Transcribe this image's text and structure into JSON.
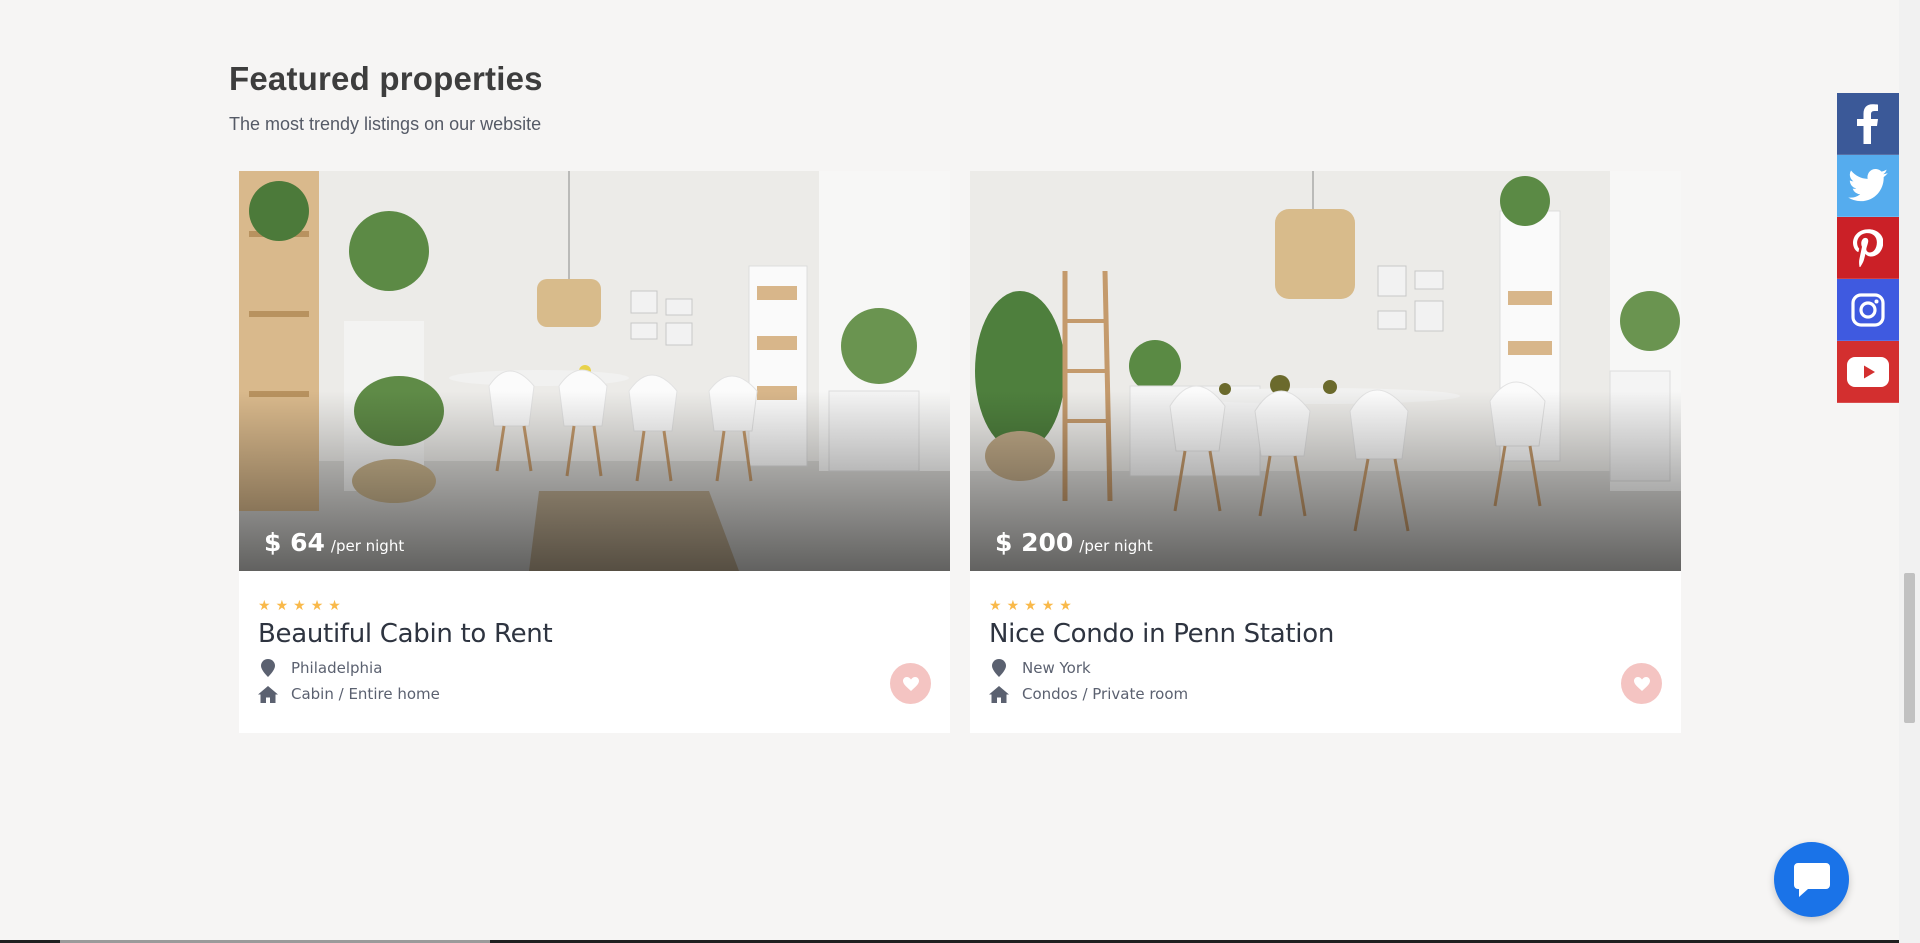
{
  "section": {
    "title": "Featured properties",
    "subtitle": "The most trendy listings on our website"
  },
  "listings": [
    {
      "price": "$ 64",
      "price_unit": "/per night",
      "rating": 5,
      "title": "Beautiful Cabin to Rent",
      "location": "Philadelphia",
      "type": "Cabin / Entire home"
    },
    {
      "price": "$ 200",
      "price_unit": "/per night",
      "rating": 5,
      "title": "Nice Condo in Penn Station",
      "location": "New York",
      "type": "Condos / Private room"
    }
  ],
  "social": [
    {
      "name": "facebook",
      "icon": "facebook-icon",
      "color": "#3b5998"
    },
    {
      "name": "twitter",
      "icon": "twitter-icon",
      "color": "#55acee"
    },
    {
      "name": "pinterest",
      "icon": "pinterest-icon",
      "color": "#cb2027"
    },
    {
      "name": "instagram",
      "icon": "instagram-icon",
      "color": "#3f5ae0"
    },
    {
      "name": "youtube",
      "icon": "youtube-icon",
      "color": "#d32f2f"
    }
  ],
  "colors": {
    "background": "#f6f5f4",
    "star": "#f9b94a",
    "favorite": "#f4c4c2",
    "chat": "#1a73e8"
  },
  "icons": {
    "location": "map-marker-icon",
    "home": "home-icon",
    "favorite": "heart-icon",
    "chat": "chat-bubble-icon",
    "star": "star-icon"
  }
}
